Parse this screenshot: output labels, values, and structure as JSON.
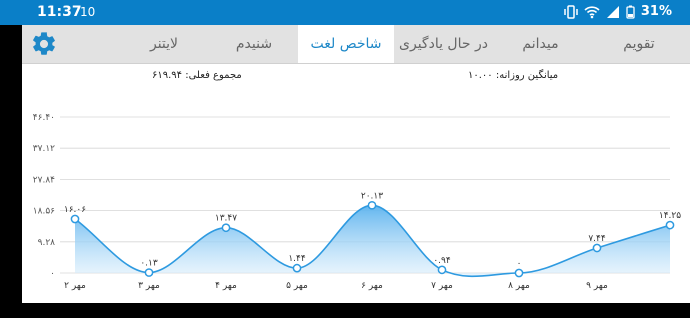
{
  "status": {
    "time": "11:37",
    "notification": "10",
    "battery": "31%"
  },
  "tabs": [
    {
      "label": "تقویم",
      "active": false
    },
    {
      "label": "میدانم",
      "active": false
    },
    {
      "label": "در حال یادگیری",
      "active": false
    },
    {
      "label": "شاخص لغت",
      "active": true
    },
    {
      "label": "شنیدم",
      "active": false
    },
    {
      "label": "لایتنر",
      "active": false
    }
  ],
  "stats": {
    "daily_average": "میانگین روزانه: ۱۰.۰۰",
    "current_total": "مجموع فعلی: ۶۱۹.۹۴"
  },
  "colors": {
    "accent": "#1e88c8",
    "statusbar": "#0a7fc8",
    "line": "#2e9ae0"
  },
  "chart_data": {
    "type": "area",
    "categories": [
      "۲ مهر",
      "۳ مهر",
      "۴ مهر",
      "۵ مهر",
      "۶ مهر",
      "۷ مهر",
      "۸ مهر",
      "۹ مهر",
      ""
    ],
    "values": [
      16.06,
      0.13,
      13.47,
      1.44,
      20.13,
      0.94,
      0,
      7.44,
      14.25
    ],
    "value_labels": [
      "۱۶.۰۶",
      "۰.۱۳",
      "۱۳.۴۷",
      "۱.۴۴",
      "۲۰.۱۳",
      "۰.۹۴",
      "۰",
      "۷.۴۴",
      "۱۴.۲۵"
    ],
    "yticks": [
      0,
      9.28,
      18.56,
      27.84,
      37.12,
      46.4
    ],
    "ytick_labels": [
      "۰",
      "۹.۲۸",
      "۱۸.۵۶",
      "۲۷.۸۴",
      "۳۷.۱۲",
      "۴۶.۴۰"
    ],
    "ylim": [
      0,
      46.4
    ],
    "grid": true
  }
}
